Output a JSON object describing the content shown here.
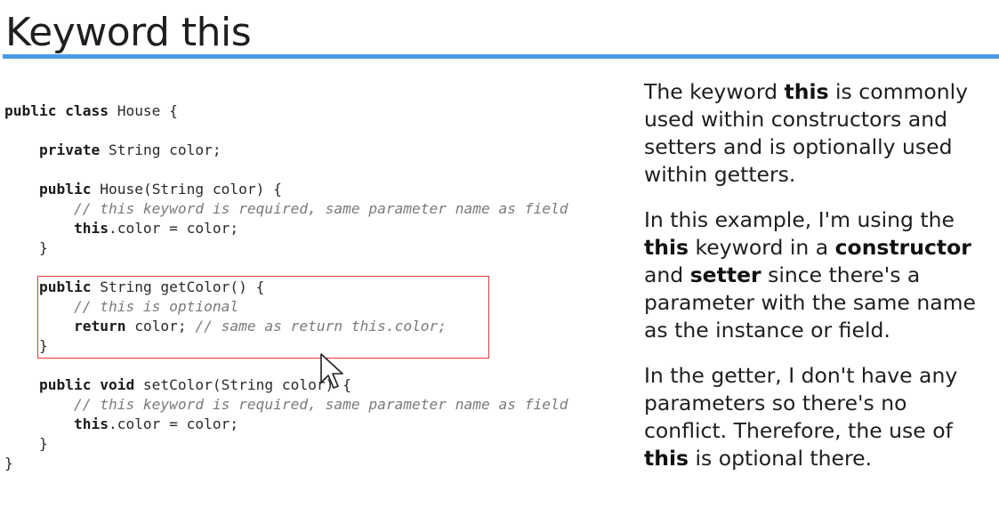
{
  "slide": {
    "title": "Keyword this"
  },
  "code": {
    "lines": [
      [
        {
          "k": "kw",
          "t": "public class"
        },
        {
          "k": "",
          "t": " House {"
        }
      ],
      [],
      [
        {
          "k": "",
          "t": "    "
        },
        {
          "k": "kw",
          "t": "private"
        },
        {
          "k": "",
          "t": " String color;"
        }
      ],
      [],
      [
        {
          "k": "",
          "t": "    "
        },
        {
          "k": "kw",
          "t": "public"
        },
        {
          "k": "",
          "t": " House(String color) {"
        }
      ],
      [
        {
          "k": "",
          "t": "        "
        },
        {
          "k": "cm",
          "t": "// this keyword is required, same parameter name as field"
        }
      ],
      [
        {
          "k": "",
          "t": "        "
        },
        {
          "k": "kw",
          "t": "this"
        },
        {
          "k": "",
          "t": ".color = color;"
        }
      ],
      [
        {
          "k": "",
          "t": "    }"
        }
      ],
      [],
      [
        {
          "k": "",
          "t": "    "
        },
        {
          "k": "kw",
          "t": "public"
        },
        {
          "k": "",
          "t": " String getColor() {"
        }
      ],
      [
        {
          "k": "",
          "t": "        "
        },
        {
          "k": "cm",
          "t": "// this is optional"
        }
      ],
      [
        {
          "k": "",
          "t": "        "
        },
        {
          "k": "kw",
          "t": "return"
        },
        {
          "k": "",
          "t": " color; "
        },
        {
          "k": "cm",
          "t": "// same as return this.color;"
        }
      ],
      [
        {
          "k": "",
          "t": "    }"
        }
      ],
      [],
      [
        {
          "k": "",
          "t": "    "
        },
        {
          "k": "kw",
          "t": "public void"
        },
        {
          "k": "",
          "t": " setColor(String color) {"
        }
      ],
      [
        {
          "k": "",
          "t": "        "
        },
        {
          "k": "cm",
          "t": "// this keyword is required, same parameter name as field"
        }
      ],
      [
        {
          "k": "",
          "t": "        "
        },
        {
          "k": "kw",
          "t": "this"
        },
        {
          "k": "",
          "t": ".color = color;"
        }
      ],
      [
        {
          "k": "",
          "t": "    }"
        }
      ],
      [
        {
          "k": "",
          "t": "}"
        }
      ]
    ]
  },
  "explanation": {
    "paragraphs": [
      [
        {
          "b": false,
          "t": "The keyword "
        },
        {
          "b": true,
          "t": "this"
        },
        {
          "b": false,
          "t": " is commonly used within constructors and setters and is optionally used within getters."
        }
      ],
      [
        {
          "b": false,
          "t": "In this example, I'm using the "
        },
        {
          "b": true,
          "t": "this"
        },
        {
          "b": false,
          "t": " keyword in a "
        },
        {
          "b": true,
          "t": "constructor"
        },
        {
          "b": false,
          "t": " and "
        },
        {
          "b": true,
          "t": "setter"
        },
        {
          "b": false,
          "t": " since there's a parameter with the same name as the instance or field."
        }
      ],
      [
        {
          "b": false,
          "t": "In the getter, I don't have any parameters so there's no conflict. Therefore, the use of "
        },
        {
          "b": true,
          "t": "this"
        },
        {
          "b": false,
          "t": " is optional there."
        }
      ]
    ]
  },
  "colors": {
    "accent_underline": "#4a9be6",
    "highlight_border": "#e23a3a"
  },
  "icons": {
    "cursor": "mouse-pointer-icon"
  }
}
